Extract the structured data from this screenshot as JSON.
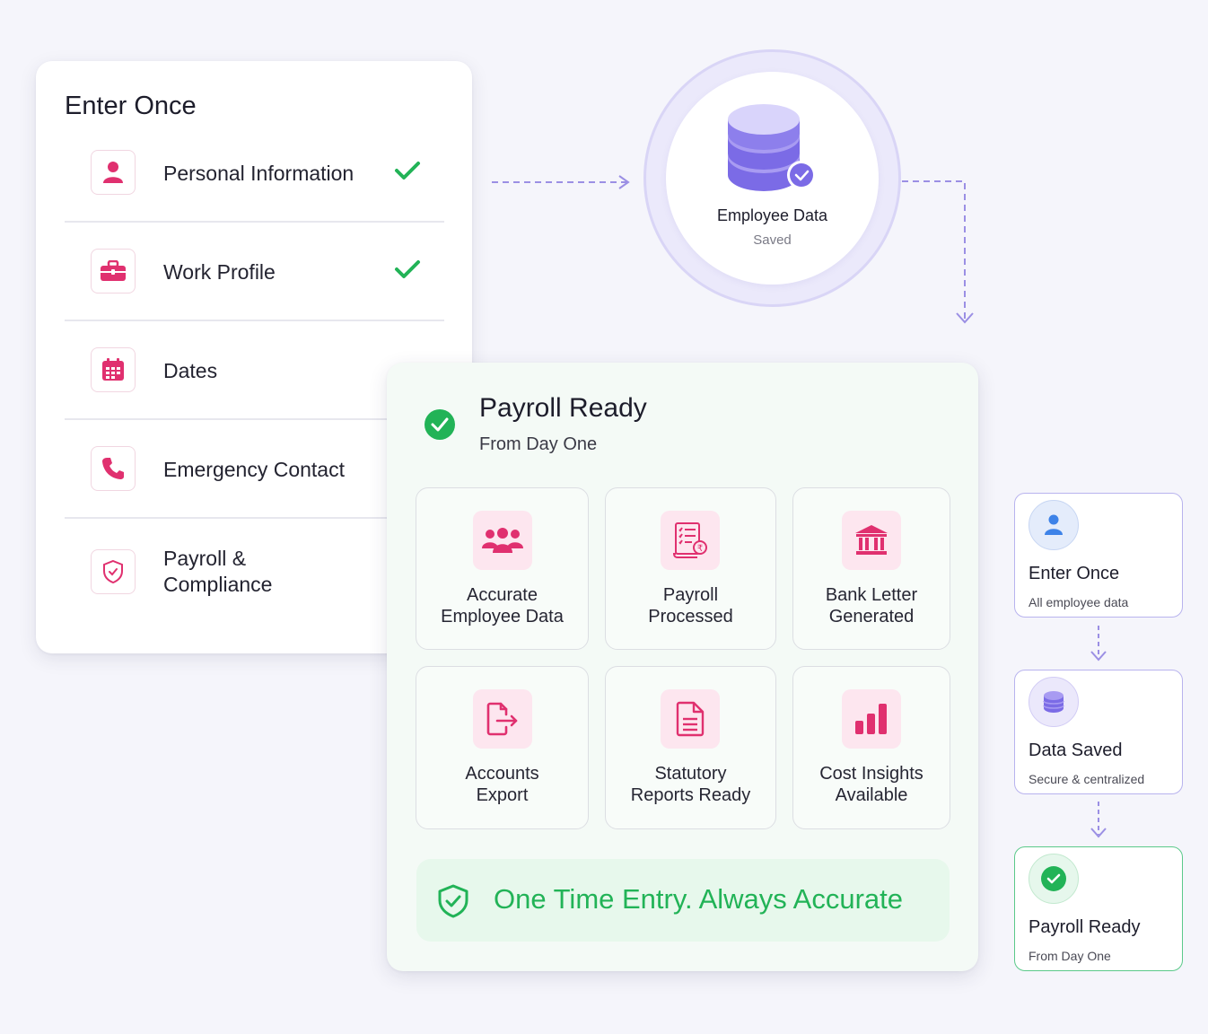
{
  "enter_once": {
    "title": "Enter Once",
    "fields": [
      {
        "label": "Personal Information",
        "icon": "user-icon",
        "completed": true
      },
      {
        "label": "Work Profile",
        "icon": "briefcase-icon",
        "completed": true
      },
      {
        "label": "Dates",
        "icon": "calendar-icon",
        "completed": false
      },
      {
        "label": "Emergency Contact",
        "icon": "phone-icon",
        "completed": false
      },
      {
        "label": "Payroll &",
        "label_line2": "Compliance",
        "icon": "shield-icon",
        "completed": false
      }
    ]
  },
  "saved": {
    "title": "Employee Data",
    "subtitle": "Saved",
    "icon": "database-icon"
  },
  "payroll": {
    "title": "Payroll Ready",
    "subtitle": "From Day One",
    "tiles": [
      {
        "line1": "Accurate",
        "line2": "Employee Data",
        "icon": "people-icon"
      },
      {
        "line1": "Payroll",
        "line2": "Processed",
        "icon": "payslip-icon"
      },
      {
        "line1": "Bank Letter",
        "line2": "Generated",
        "icon": "bank-icon"
      },
      {
        "line1": "Accounts",
        "line2": "Export",
        "icon": "export-icon"
      },
      {
        "line1": "Statutory",
        "line2": "Reports Ready",
        "icon": "document-icon"
      },
      {
        "line1": "Cost Insights",
        "line2": "Available",
        "icon": "bar-chart-icon"
      }
    ],
    "banner": "One Time Entry. Always Accurate"
  },
  "flow": [
    {
      "title": "Enter Once",
      "subtitle": "All employee data",
      "icon": "user-icon"
    },
    {
      "title": "Data Saved",
      "subtitle": "Secure & centralized",
      "icon": "database-icon"
    },
    {
      "title": "Payroll Ready",
      "subtitle": "From Day One",
      "icon": "check-circle-icon"
    }
  ],
  "colors": {
    "accent_pink": "#e0306f",
    "accent_purple": "#7b6be6",
    "accent_green": "#22b357",
    "background": "#f5f5fb"
  }
}
